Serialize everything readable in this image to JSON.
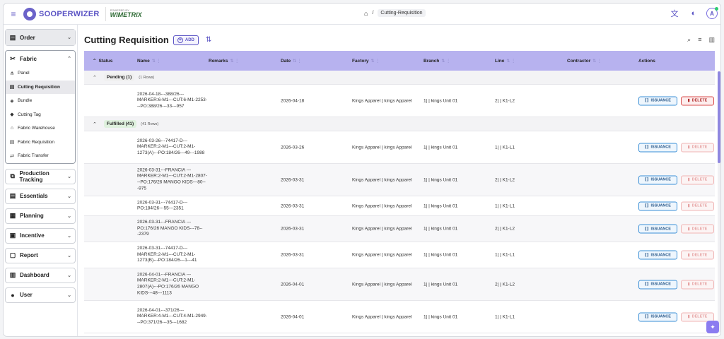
{
  "app": {
    "logo_text": "SOOPERWIZER",
    "powered_small": "POWERED BY",
    "powered_brand": "WIMETRIX"
  },
  "breadcrumb": {
    "current": "Cutting-Requisition"
  },
  "sidebar": {
    "order_label": "Order",
    "fabric_label": "Fabric",
    "fabric_items": [
      {
        "label": "Panel",
        "icon": "panel-icon"
      },
      {
        "label": "Cutting Requisition",
        "icon": "requisition-icon"
      },
      {
        "label": "Bundle",
        "icon": "bundle-icon"
      },
      {
        "label": "Cutting Tag",
        "icon": "tag-icon"
      },
      {
        "label": "Fabric Warehouse",
        "icon": "warehouse-icon"
      },
      {
        "label": "Fabric Requisition",
        "icon": "requisition-icon"
      },
      {
        "label": "Fabric Transfer",
        "icon": "transfer-icon"
      }
    ],
    "nav": [
      {
        "label": "Production Tracking",
        "icon": "tracking-icon"
      },
      {
        "label": "Essentials",
        "icon": "essentials-icon"
      },
      {
        "label": "Planning",
        "icon": "calendar-icon"
      },
      {
        "label": "Incentive",
        "icon": "incentive-icon"
      },
      {
        "label": "Report",
        "icon": "report-icon"
      },
      {
        "label": "Dashboard",
        "icon": "dashboard-icon"
      },
      {
        "label": "User",
        "icon": "user-icon"
      }
    ]
  },
  "page": {
    "title": "Cutting Requisition",
    "add_label": "ADD"
  },
  "table": {
    "headers": {
      "status": "Status",
      "name": "Name",
      "remarks": "Remarks",
      "date": "Date",
      "factory": "Factory",
      "branch": "Branch",
      "line": "Line",
      "contractor": "Contractor",
      "actions": "Actions"
    },
    "issuance_label": "ISSUANCE",
    "delete_label": "DELETE",
    "groups": {
      "pending": {
        "label": "Pending (1)",
        "count": "(1 Rows)"
      },
      "fulfilled": {
        "label": "Fulfilled (41)",
        "count": "(41 Rows)"
      }
    },
    "rows": [
      {
        "name": "2026-04-18---388/26---MARKER:6-M1---CUT:6-M1-2253---PO:388/26---33---957",
        "date": "2026-04-18",
        "factory": "Kings Apparel | kings Apparel",
        "branch": "1| | kings Unit 01",
        "line": "2| | K1-L2"
      },
      {
        "name": "2026-03-26---74417-D---MARKER:2-M1---CUT:2-M1-1273(A)---PO:184/26---49---1988",
        "date": "2026-03-26",
        "factory": "Kings Apparel | kings Apparel",
        "branch": "1| | kings Unit 01",
        "line": "1| | K1-L1"
      },
      {
        "name": "2026-03-31---FRANCIA ---MARKER:2-M1---CUT:2-M1-2807---PO:176/26 MANGO KIDS---80---975",
        "date": "2026-03-31",
        "factory": "Kings Apparel | kings Apparel",
        "branch": "1| | kings Unit 01",
        "line": "2| | K1-L2"
      },
      {
        "name": "2026-03-31---74417-D---PO:184/26---55---2351",
        "date": "2026-03-31",
        "factory": "Kings Apparel | kings Apparel",
        "branch": "1| | kings Unit 01",
        "line": "1| | K1-L1"
      },
      {
        "name": "2026-03-31---FRANCIA ---PO:176/26 MANGO KIDS---78---2379",
        "date": "2026-03-31",
        "factory": "Kings Apparel | kings Apparel",
        "branch": "1| | kings Unit 01",
        "line": "2| | K1-L2"
      },
      {
        "name": "2026-03-31---74417-D---MARKER:2-M1---CUT:2-M1-1273(B)---PO:184/26---1---41",
        "date": "2026-03-31",
        "factory": "Kings Apparel | kings Apparel",
        "branch": "1| | kings Unit 01",
        "line": "1| | K1-L1"
      },
      {
        "name": "2026-04-01---FRANCIA ---MARKER:2-M1---CUT:2-M1-2807(A)---PO:176/26 MANGO KIDS---48---1113",
        "date": "2026-04-01",
        "factory": "Kings Apparel | kings Apparel",
        "branch": "1| | kings Unit 01",
        "line": "2| | K1-L2"
      },
      {
        "name": "2026-04-01---371/26---MARKER:4-M1---CUT:4-M1-2949---PO:371/26---35---1682",
        "date": "2026-04-01",
        "factory": "Kings Apparel | kings Apparel",
        "branch": "1| | kings Unit 01",
        "line": "1| | K1-L1"
      }
    ]
  },
  "colors": {
    "accent": "#5a53c4",
    "header_bg": "#b7b2ef",
    "issuance": "#3a8fd6",
    "delete": "#d94c4c"
  }
}
